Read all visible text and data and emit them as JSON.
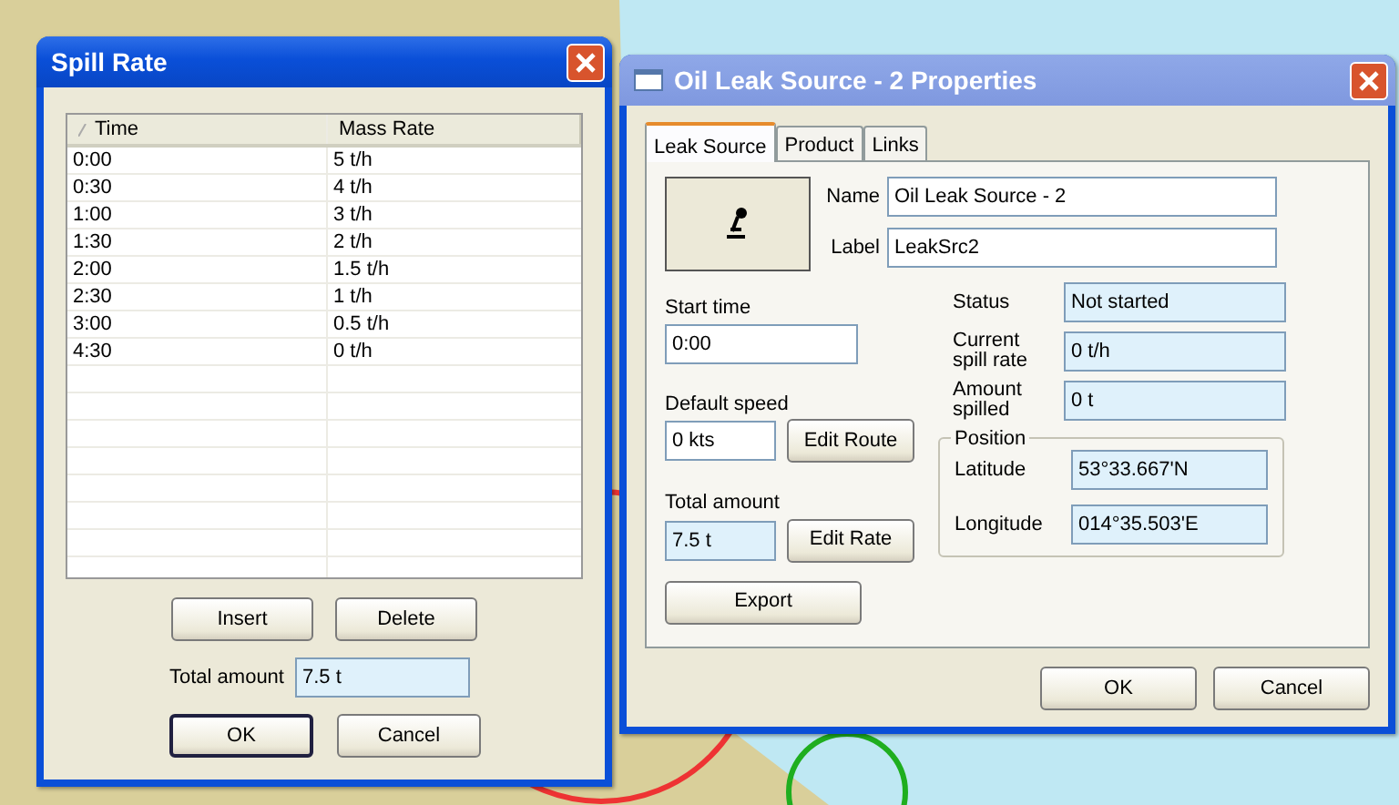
{
  "spill_window": {
    "title": "Spill Rate",
    "columns": [
      {
        "label": "Time",
        "sorted": true
      },
      {
        "label": "Mass Rate",
        "sorted": false
      }
    ],
    "rows": [
      [
        "0:00",
        "5 t/h"
      ],
      [
        "0:30",
        "4 t/h"
      ],
      [
        "1:00",
        "3 t/h"
      ],
      [
        "1:30",
        "2 t/h"
      ],
      [
        "2:00",
        "1.5 t/h"
      ],
      [
        "2:30",
        "1 t/h"
      ],
      [
        "3:00",
        "0.5 t/h"
      ],
      [
        "4:30",
        "0 t/h"
      ]
    ],
    "table_buttons": [
      "Insert",
      "Delete"
    ],
    "total_amount": {
      "label": "Total amount",
      "value": "7.5 t",
      "readonly": true
    },
    "buttons": [
      {
        "label": "OK",
        "default": true
      },
      {
        "label": "Cancel",
        "default": false
      }
    ]
  },
  "properties_window": {
    "title": "Oil Leak Source - 2 Properties",
    "tabs": [
      {
        "label": "Leak Source",
        "selected": true
      },
      {
        "label": "Product",
        "selected": false
      },
      {
        "label": "Links",
        "selected": false
      }
    ],
    "name": {
      "label": "Name",
      "value": "Oil Leak Source - 2",
      "readonly": false
    },
    "label": {
      "label": "Label",
      "value": "LeakSrc2",
      "readonly": false
    },
    "start_time": {
      "label": "Start time",
      "value": "0:00",
      "readonly": false
    },
    "default_speed": {
      "label": "Default speed",
      "value": "0 kts",
      "readonly": false,
      "button": "Edit Route"
    },
    "total_amount": {
      "label": "Total amount",
      "value": "7.5 t",
      "readonly": true,
      "button": "Edit Rate"
    },
    "status_fields": [
      {
        "label": "Status",
        "value": "Not started",
        "readonly": true
      },
      {
        "label": "Current spill rate",
        "value": "0 t/h",
        "readonly": true
      },
      {
        "label": "Amount spilled",
        "value": "0 t",
        "readonly": true
      }
    ],
    "position": {
      "title": "Position",
      "fields": [
        {
          "label": "Latitude",
          "value": "53°33.667'N",
          "readonly": true
        },
        {
          "label": "Longitude",
          "value": "014°35.503'E",
          "readonly": true
        }
      ]
    },
    "export_button": "Export",
    "buttons": [
      {
        "label": "OK",
        "default": false
      },
      {
        "label": "Cancel",
        "default": false
      }
    ]
  }
}
